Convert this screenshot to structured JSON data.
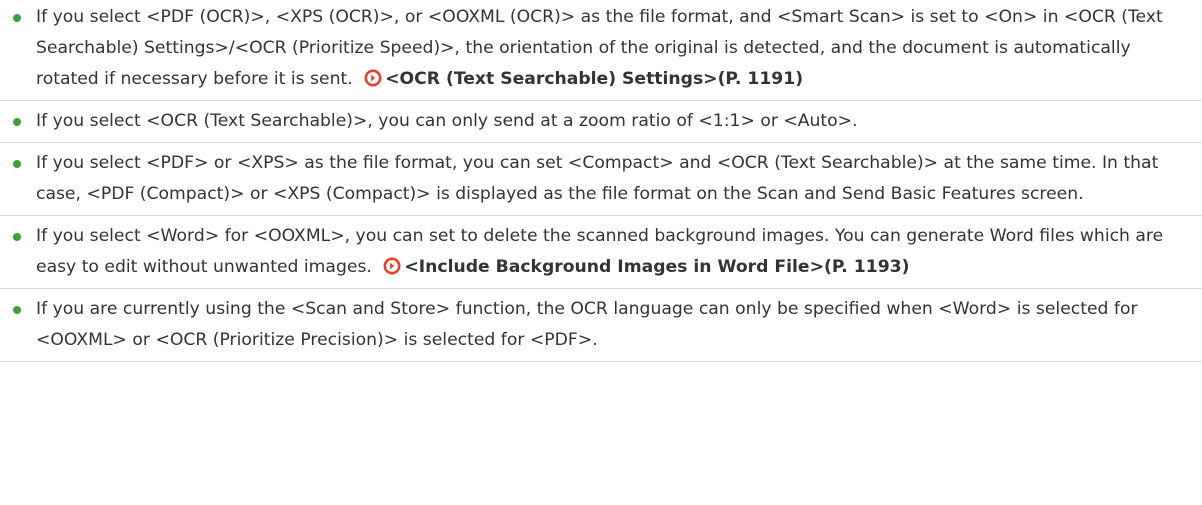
{
  "colors": {
    "bullet": "#3e9e3e",
    "link_icon": "#e8422b",
    "text": "#333333",
    "divider": "#dcdcdc"
  },
  "notes": [
    {
      "text": "If you select <PDF (OCR)>, <XPS (OCR)>, or <OOXML (OCR)> as the file format, and <Smart Scan> is set to <On> in <OCR (Text Searchable) Settings>/<OCR (Prioritize Speed)>, the orientation of the original is detected, and the document is automatically rotated if necessary before it is sent.",
      "link": "<OCR (Text Searchable) Settings>(P. 1191)",
      "link_icon": "circle-arrow-icon"
    },
    {
      "text": "If you select <OCR (Text Searchable)>, you can only send at a zoom ratio of <1:1> or <Auto>."
    },
    {
      "text": "If you select <PDF> or <XPS> as the file format, you can set <Compact> and <OCR (Text Searchable)> at the same time. In that case, <PDF (Compact)> or <XPS (Compact)> is displayed as the file format on the Scan and Send Basic Features screen."
    },
    {
      "text": "If you select <Word> for <OOXML>, you can set to delete the scanned background images. You can generate Word files which are easy to edit without unwanted images.",
      "link": "<Include Background Images in Word File>(P. 1193)",
      "link_icon": "circle-arrow-icon"
    },
    {
      "text": "If you are currently using the <Scan and Store> function, the OCR language can only be specified when <Word> is selected for <OOXML> or <OCR (Prioritize Precision)> is selected for <PDF>."
    }
  ]
}
